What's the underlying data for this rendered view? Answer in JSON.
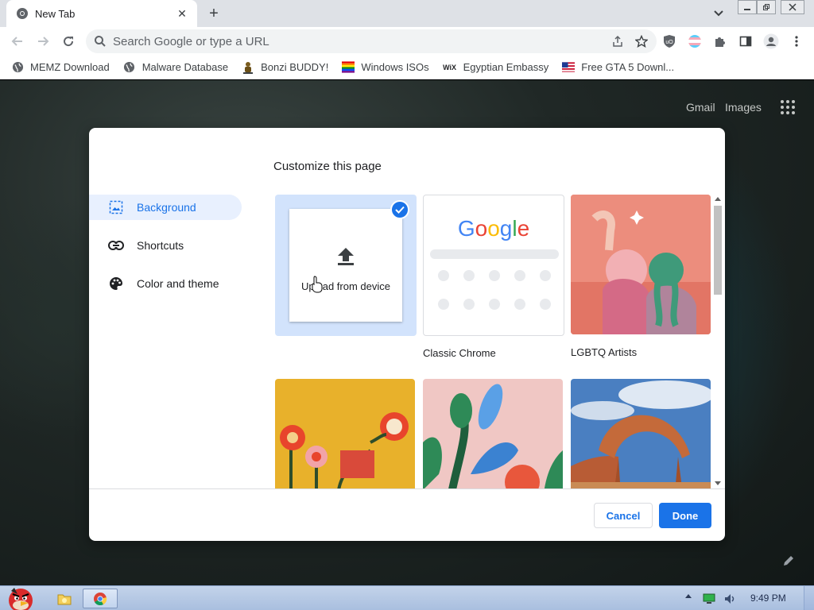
{
  "browser": {
    "tab": {
      "title": "New Tab"
    },
    "omnibox": {
      "placeholder": "Search Google or type a URL"
    },
    "bookmarks": [
      {
        "label": "MEMZ Download",
        "icon": "globe-icon"
      },
      {
        "label": "Malware Database",
        "icon": "globe-icon"
      },
      {
        "label": "Bonzi BUDDY!",
        "icon": "bonzi-icon"
      },
      {
        "label": "Windows ISOs",
        "icon": "windows-flag-icon"
      },
      {
        "label": "Egyptian Embassy",
        "icon": "wix-icon"
      },
      {
        "label": "Free GTA 5 Downl...",
        "icon": "flag-icon"
      }
    ],
    "wix_text": "WiX"
  },
  "ntp": {
    "gmail": "Gmail",
    "images": "Images"
  },
  "dialog": {
    "title": "Customize this page",
    "menu": [
      {
        "label": "Background",
        "icon": "image-icon",
        "active": true
      },
      {
        "label": "Shortcuts",
        "icon": "link-icon",
        "active": false
      },
      {
        "label": "Color and theme",
        "icon": "palette-icon",
        "active": false
      }
    ],
    "tiles": {
      "upload": {
        "label": "Upload from device",
        "selected": true
      },
      "classic": {
        "label": "Classic Chrome",
        "google_text": "Google"
      },
      "lgbtq": {
        "label": "LGBTQ Artists"
      }
    },
    "buttons": {
      "cancel": "Cancel",
      "done": "Done"
    }
  },
  "taskbar": {
    "clock": "9:49 PM"
  },
  "colors": {
    "accent": "#1a73e8",
    "selection_bg": "#e8f0fe"
  }
}
